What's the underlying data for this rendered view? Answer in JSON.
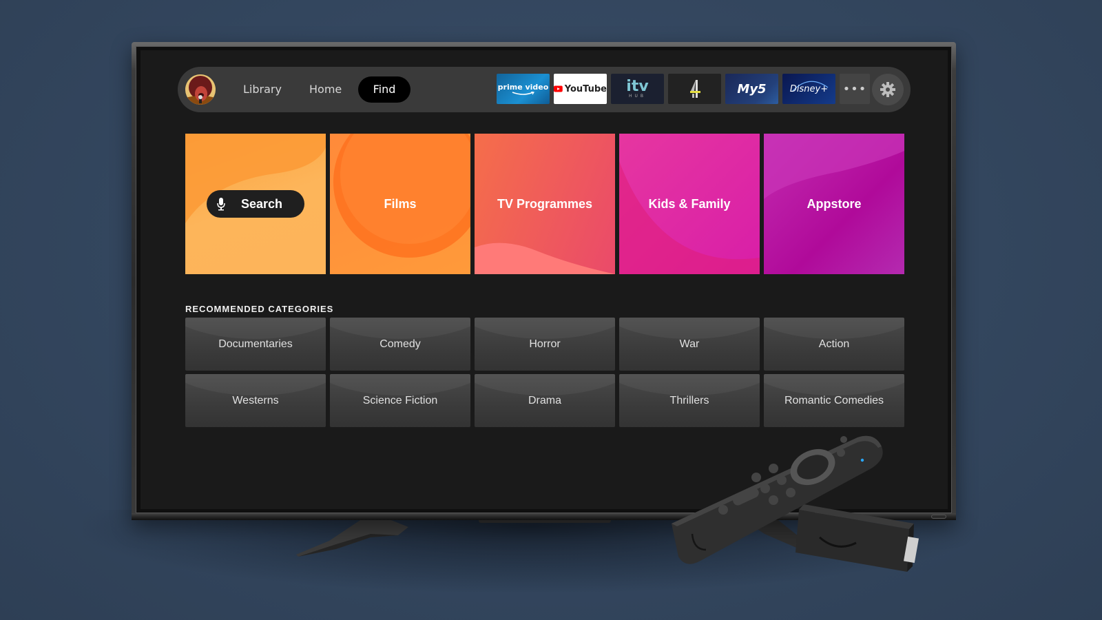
{
  "nav": {
    "avatar": "profile-avatar",
    "links": [
      {
        "label": "Library",
        "active": false
      },
      {
        "label": "Home",
        "active": false
      },
      {
        "label": "Find",
        "active": true
      }
    ],
    "apps": [
      {
        "name": "prime-video",
        "label": "prime video"
      },
      {
        "name": "youtube",
        "label": "YouTube"
      },
      {
        "name": "itv-hub",
        "label": "itv",
        "sublabel": "HUB"
      },
      {
        "name": "channel-4",
        "label": "4"
      },
      {
        "name": "my5",
        "label": "My5"
      },
      {
        "name": "disney-plus",
        "label": "Disney+"
      }
    ],
    "more_label": "•••",
    "settings_icon": "gear-icon"
  },
  "tiles": [
    {
      "label": "Search",
      "icon": "microphone-icon",
      "color": "#fdb55a"
    },
    {
      "label": "Films",
      "color": "#ff8a3a"
    },
    {
      "label": "TV Programmes",
      "color": "#ef5a5a"
    },
    {
      "label": "Kids & Family",
      "color": "#e02ea6"
    },
    {
      "label": "Appstore",
      "color": "#b414a0"
    }
  ],
  "categories": {
    "heading": "RECOMMENDED CATEGORIES",
    "items": [
      "Documentaries",
      "Comedy",
      "Horror",
      "War",
      "Action",
      "Westerns",
      "Science Fiction",
      "Drama",
      "Thrillers",
      "Romantic Comedies"
    ]
  },
  "colors": {
    "background": "#33465e",
    "screen": "#1a1a1a",
    "nav_bar": "#3a3a3a",
    "active_pill": "#000000"
  }
}
